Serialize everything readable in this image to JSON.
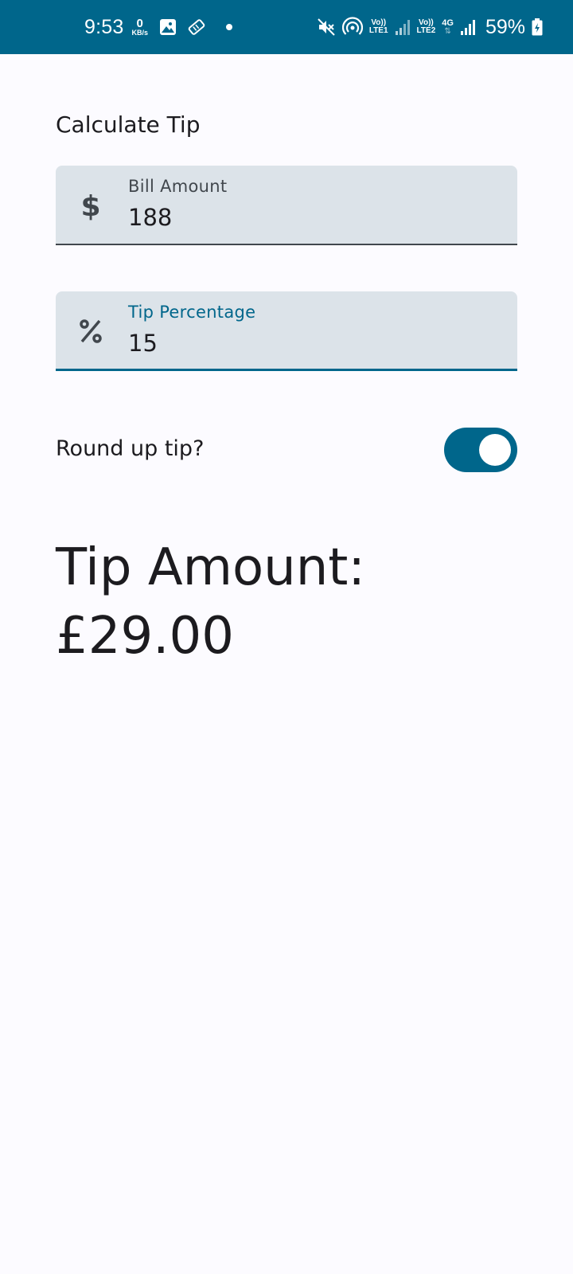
{
  "status_bar": {
    "time": "9:53",
    "data_rate_value": "0",
    "data_rate_unit": "KB/s",
    "sim1_top": "Vo))",
    "sim1_bottom": "LTE1",
    "sim2_top": "Vo))",
    "sim2_bottom": "LTE2",
    "network_type": "4G",
    "battery_percent": "59%",
    "icons": [
      "gallery-icon",
      "ticket-icon",
      "mute-icon",
      "hotspot-icon",
      "signal-icon",
      "battery-charging-icon"
    ]
  },
  "screen": {
    "title": "Calculate Tip",
    "bill_field": {
      "label": "Bill Amount",
      "value": "188",
      "icon": "dollar-icon"
    },
    "tip_field": {
      "label": "Tip Percentage",
      "value": "15",
      "icon": "percent-icon"
    },
    "round_up": {
      "label": "Round up tip?",
      "enabled": true
    },
    "result": {
      "label": "Tip Amount:",
      "value": "£29.00"
    }
  },
  "colors": {
    "primary": "#00668b",
    "field_bg": "#dce3e9",
    "background": "#fcfbff",
    "text": "#1c1b1f"
  }
}
